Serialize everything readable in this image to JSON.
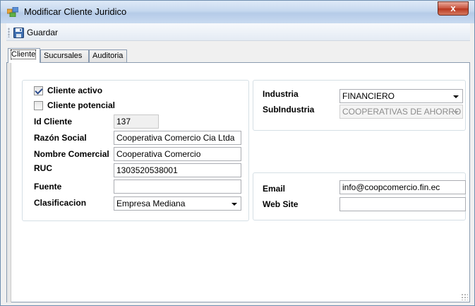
{
  "window": {
    "title": "Modificar Cliente Juridico",
    "close_glyph": "x"
  },
  "toolbar": {
    "save_label": "Guardar",
    "save_icon": "floppy-disk-icon"
  },
  "tabs": [
    {
      "label": "Cliente",
      "active": true
    },
    {
      "label": "Sucursales",
      "active": false
    },
    {
      "label": "Auditoria",
      "active": false
    }
  ],
  "client": {
    "active_label": "Cliente activo",
    "active_checked": true,
    "potential_label": "Cliente potencial",
    "potential_checked": false,
    "id_label": "Id Cliente",
    "id_value": "137",
    "razon_label": "Razón Social",
    "razon_value": "Cooperativa Comercio Cia Ltda",
    "nombre_label": "Nombre Comercial",
    "nombre_value": "Cooperativa Comercio",
    "ruc_label": "RUC",
    "ruc_value": "1303520538001",
    "fuente_label": "Fuente",
    "fuente_value": "",
    "clasificacion_label": "Clasificacion",
    "clasificacion_value": "Empresa Mediana"
  },
  "industry": {
    "industria_label": "Industria",
    "industria_value": "FINANCIERO",
    "subindustria_label": "SubIndustria",
    "subindustria_value": "COOPERATIVAS DE AHORRO"
  },
  "contact": {
    "email_label": "Email",
    "email_value": "info@coopcomercio.fin.ec",
    "website_label": "Web Site",
    "website_value": ""
  },
  "colors": {
    "close_button": "#c7523c",
    "titlebar": "#c6d8ef",
    "check_mark": "#2a4a8a"
  }
}
